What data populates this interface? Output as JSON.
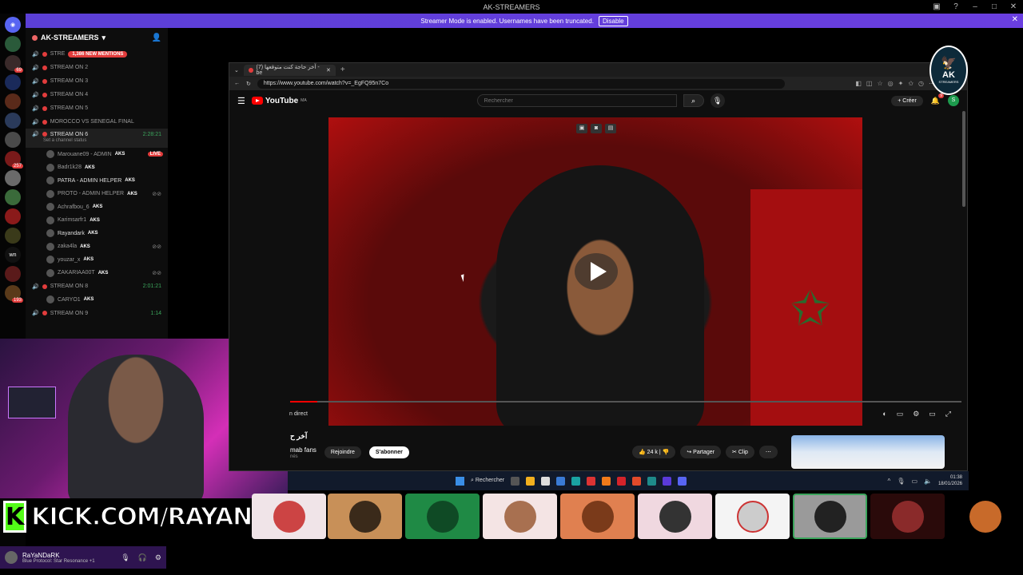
{
  "window": {
    "title": "AK-STREAMERS"
  },
  "banner": {
    "text": "Streamer Mode is enabled. Usernames have been truncated.",
    "button": "Disable"
  },
  "server": {
    "name": "AK-STREAMERS"
  },
  "channels": [
    {
      "name": "STRE",
      "mention": "1,386 NEW MENTIONS"
    },
    {
      "name": "STREAM ON 2"
    },
    {
      "name": "STREAM ON 3"
    },
    {
      "name": "STREAM ON 4"
    },
    {
      "name": "STREAM ON 5"
    },
    {
      "name": "MOROCCO VS SENEGAL FINAL"
    }
  ],
  "active_channel": {
    "name": "STREAM ON 6",
    "time": "2:28:21",
    "status": "Set a channel status"
  },
  "members": [
    {
      "name": "Marouane09 - ADMIN",
      "tag": "AKS",
      "live": "LIVE"
    },
    {
      "name": "Badr1k28",
      "tag": "AKS"
    },
    {
      "name": "PATRA - ADMIN HELPER",
      "tag": "AKS"
    },
    {
      "name": "PROTO - ADMIN HELPER",
      "tag": "AKS"
    },
    {
      "name": "Achrafbou_6",
      "tag": "AKS"
    },
    {
      "name": "Karimsarfr1",
      "tag": "AKS"
    },
    {
      "name": "Rayandark",
      "tag": "AKS"
    },
    {
      "name": "zaka4la",
      "tag": "AKS"
    },
    {
      "name": "youzar_x",
      "tag": "AKS"
    },
    {
      "name": "ZAKARIAA00T",
      "tag": "AKS"
    }
  ],
  "channel8": {
    "name": "STREAM ON 8",
    "time": "2:01:21",
    "member": "CARYO1",
    "tag": "AKS"
  },
  "channel9": {
    "name": "STREAM ON 9",
    "time": "1:14"
  },
  "kick": {
    "logo": "K",
    "text": "KICK.COM/RAYANDARK"
  },
  "user": {
    "name": "RaYaNDaRK",
    "status": "Blue Protocol: Star Resonance +1"
  },
  "browser": {
    "tab_title": "(7) آخر حاجة كنت متوقعها - be",
    "url": "https://www.youtube.com/watch?v=_EgFQ95n7Co"
  },
  "youtube": {
    "logo": "YouTube",
    "region": "MA",
    "search_placeholder": "Rechercher",
    "create": "Créer",
    "notif_count": "9",
    "account_initial": "S",
    "live_label": "n direct",
    "title": "آخر ح",
    "channel": "mab fans",
    "subs": "nés",
    "join": "Rejoindre",
    "subscribe": "S'abonner",
    "likes": "24 k",
    "share": "Partager",
    "clip": "Clip",
    "progress": 0.04
  },
  "taskbar": {
    "search": "Rechercher",
    "time": "01:38",
    "date": "18/01/2026"
  },
  "logo": {
    "text": "AK",
    "sub": "STREAMERS"
  },
  "colors": {
    "accent": "#5865f2",
    "live": "#e23c3c",
    "green": "#3ba55c",
    "kick": "#53fc18"
  }
}
